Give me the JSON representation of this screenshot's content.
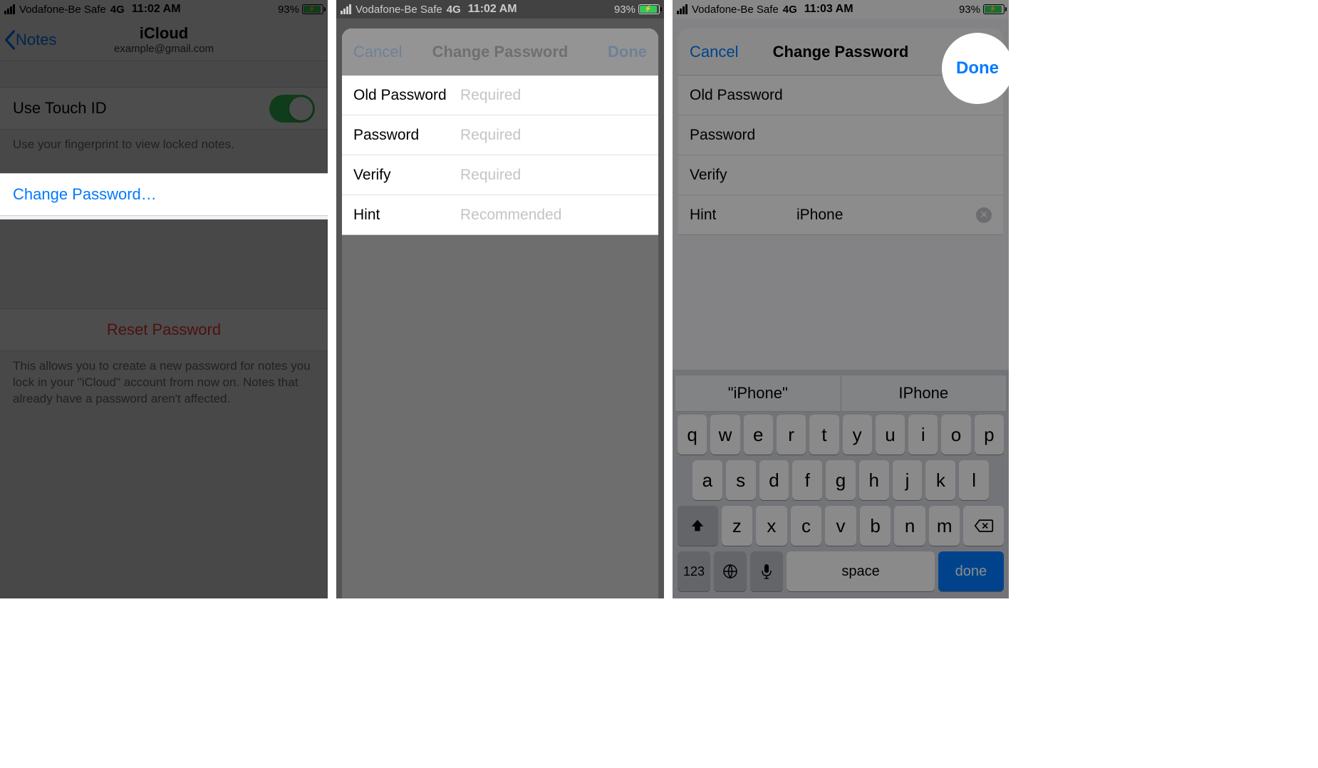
{
  "status": {
    "carrier": "Vodafone-Be Safe",
    "network": "4G",
    "time1": "11:02 AM",
    "time2": "11:02 AM",
    "time3": "11:03 AM",
    "battery_pct": "93%"
  },
  "screen1": {
    "back_label": "Notes",
    "title": "iCloud",
    "subtitle": "example@gmail.com",
    "touchid_label": "Use Touch ID",
    "touchid_footer": "Use your fingerprint to view locked notes.",
    "change_pw": "Change Password…",
    "reset_pw": "Reset Password",
    "reset_footer": "This allows you to create a new password for notes you lock in your \"iCloud\" account from now on. Notes that already have a password aren't affected."
  },
  "sheet": {
    "cancel": "Cancel",
    "title": "Change Password",
    "done": "Done",
    "fields": {
      "old": "Old Password",
      "pw": "Password",
      "verify": "Verify",
      "hint": "Hint"
    },
    "placeholders": {
      "required": "Required",
      "recommended": "Recommended"
    },
    "hint_value": "iPhone"
  },
  "keyboard": {
    "suggestions": [
      "\"iPhone\"",
      "IPhone"
    ],
    "row1": [
      "q",
      "w",
      "e",
      "r",
      "t",
      "y",
      "u",
      "i",
      "o",
      "p"
    ],
    "row2": [
      "a",
      "s",
      "d",
      "f",
      "g",
      "h",
      "j",
      "k",
      "l"
    ],
    "row3": [
      "z",
      "x",
      "c",
      "v",
      "b",
      "n",
      "m"
    ],
    "num_key": "123",
    "space": "space",
    "done": "done"
  }
}
